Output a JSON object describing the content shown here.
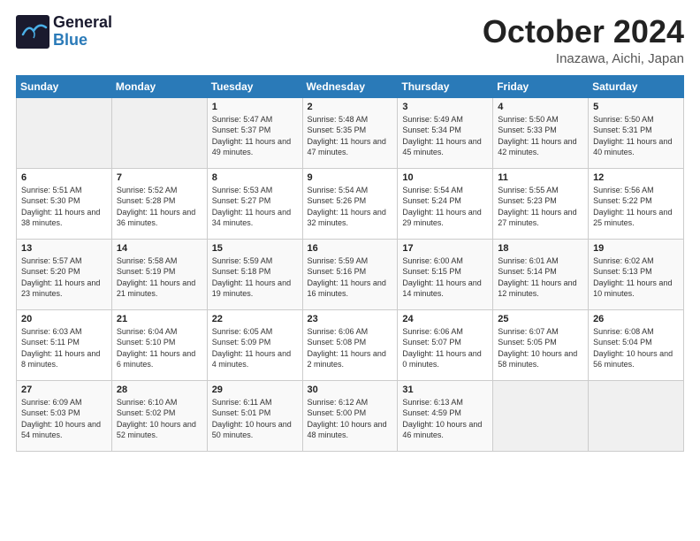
{
  "logo": {
    "line1": "General",
    "line2": "Blue"
  },
  "title": "October 2024",
  "location": "Inazawa, Aichi, Japan",
  "days_of_week": [
    "Sunday",
    "Monday",
    "Tuesday",
    "Wednesday",
    "Thursday",
    "Friday",
    "Saturday"
  ],
  "weeks": [
    [
      {
        "day": "",
        "empty": true
      },
      {
        "day": "",
        "empty": true
      },
      {
        "day": "1",
        "sunrise": "Sunrise: 5:47 AM",
        "sunset": "Sunset: 5:37 PM",
        "daylight": "Daylight: 11 hours and 49 minutes."
      },
      {
        "day": "2",
        "sunrise": "Sunrise: 5:48 AM",
        "sunset": "Sunset: 5:35 PM",
        "daylight": "Daylight: 11 hours and 47 minutes."
      },
      {
        "day": "3",
        "sunrise": "Sunrise: 5:49 AM",
        "sunset": "Sunset: 5:34 PM",
        "daylight": "Daylight: 11 hours and 45 minutes."
      },
      {
        "day": "4",
        "sunrise": "Sunrise: 5:50 AM",
        "sunset": "Sunset: 5:33 PM",
        "daylight": "Daylight: 11 hours and 42 minutes."
      },
      {
        "day": "5",
        "sunrise": "Sunrise: 5:50 AM",
        "sunset": "Sunset: 5:31 PM",
        "daylight": "Daylight: 11 hours and 40 minutes."
      }
    ],
    [
      {
        "day": "6",
        "sunrise": "Sunrise: 5:51 AM",
        "sunset": "Sunset: 5:30 PM",
        "daylight": "Daylight: 11 hours and 38 minutes."
      },
      {
        "day": "7",
        "sunrise": "Sunrise: 5:52 AM",
        "sunset": "Sunset: 5:28 PM",
        "daylight": "Daylight: 11 hours and 36 minutes."
      },
      {
        "day": "8",
        "sunrise": "Sunrise: 5:53 AM",
        "sunset": "Sunset: 5:27 PM",
        "daylight": "Daylight: 11 hours and 34 minutes."
      },
      {
        "day": "9",
        "sunrise": "Sunrise: 5:54 AM",
        "sunset": "Sunset: 5:26 PM",
        "daylight": "Daylight: 11 hours and 32 minutes."
      },
      {
        "day": "10",
        "sunrise": "Sunrise: 5:54 AM",
        "sunset": "Sunset: 5:24 PM",
        "daylight": "Daylight: 11 hours and 29 minutes."
      },
      {
        "day": "11",
        "sunrise": "Sunrise: 5:55 AM",
        "sunset": "Sunset: 5:23 PM",
        "daylight": "Daylight: 11 hours and 27 minutes."
      },
      {
        "day": "12",
        "sunrise": "Sunrise: 5:56 AM",
        "sunset": "Sunset: 5:22 PM",
        "daylight": "Daylight: 11 hours and 25 minutes."
      }
    ],
    [
      {
        "day": "13",
        "sunrise": "Sunrise: 5:57 AM",
        "sunset": "Sunset: 5:20 PM",
        "daylight": "Daylight: 11 hours and 23 minutes."
      },
      {
        "day": "14",
        "sunrise": "Sunrise: 5:58 AM",
        "sunset": "Sunset: 5:19 PM",
        "daylight": "Daylight: 11 hours and 21 minutes."
      },
      {
        "day": "15",
        "sunrise": "Sunrise: 5:59 AM",
        "sunset": "Sunset: 5:18 PM",
        "daylight": "Daylight: 11 hours and 19 minutes."
      },
      {
        "day": "16",
        "sunrise": "Sunrise: 5:59 AM",
        "sunset": "Sunset: 5:16 PM",
        "daylight": "Daylight: 11 hours and 16 minutes."
      },
      {
        "day": "17",
        "sunrise": "Sunrise: 6:00 AM",
        "sunset": "Sunset: 5:15 PM",
        "daylight": "Daylight: 11 hours and 14 minutes."
      },
      {
        "day": "18",
        "sunrise": "Sunrise: 6:01 AM",
        "sunset": "Sunset: 5:14 PM",
        "daylight": "Daylight: 11 hours and 12 minutes."
      },
      {
        "day": "19",
        "sunrise": "Sunrise: 6:02 AM",
        "sunset": "Sunset: 5:13 PM",
        "daylight": "Daylight: 11 hours and 10 minutes."
      }
    ],
    [
      {
        "day": "20",
        "sunrise": "Sunrise: 6:03 AM",
        "sunset": "Sunset: 5:11 PM",
        "daylight": "Daylight: 11 hours and 8 minutes."
      },
      {
        "day": "21",
        "sunrise": "Sunrise: 6:04 AM",
        "sunset": "Sunset: 5:10 PM",
        "daylight": "Daylight: 11 hours and 6 minutes."
      },
      {
        "day": "22",
        "sunrise": "Sunrise: 6:05 AM",
        "sunset": "Sunset: 5:09 PM",
        "daylight": "Daylight: 11 hours and 4 minutes."
      },
      {
        "day": "23",
        "sunrise": "Sunrise: 6:06 AM",
        "sunset": "Sunset: 5:08 PM",
        "daylight": "Daylight: 11 hours and 2 minutes."
      },
      {
        "day": "24",
        "sunrise": "Sunrise: 6:06 AM",
        "sunset": "Sunset: 5:07 PM",
        "daylight": "Daylight: 11 hours and 0 minutes."
      },
      {
        "day": "25",
        "sunrise": "Sunrise: 6:07 AM",
        "sunset": "Sunset: 5:05 PM",
        "daylight": "Daylight: 10 hours and 58 minutes."
      },
      {
        "day": "26",
        "sunrise": "Sunrise: 6:08 AM",
        "sunset": "Sunset: 5:04 PM",
        "daylight": "Daylight: 10 hours and 56 minutes."
      }
    ],
    [
      {
        "day": "27",
        "sunrise": "Sunrise: 6:09 AM",
        "sunset": "Sunset: 5:03 PM",
        "daylight": "Daylight: 10 hours and 54 minutes."
      },
      {
        "day": "28",
        "sunrise": "Sunrise: 6:10 AM",
        "sunset": "Sunset: 5:02 PM",
        "daylight": "Daylight: 10 hours and 52 minutes."
      },
      {
        "day": "29",
        "sunrise": "Sunrise: 6:11 AM",
        "sunset": "Sunset: 5:01 PM",
        "daylight": "Daylight: 10 hours and 50 minutes."
      },
      {
        "day": "30",
        "sunrise": "Sunrise: 6:12 AM",
        "sunset": "Sunset: 5:00 PM",
        "daylight": "Daylight: 10 hours and 48 minutes."
      },
      {
        "day": "31",
        "sunrise": "Sunrise: 6:13 AM",
        "sunset": "Sunset: 4:59 PM",
        "daylight": "Daylight: 10 hours and 46 minutes."
      },
      {
        "day": "",
        "empty": true
      },
      {
        "day": "",
        "empty": true
      }
    ]
  ]
}
